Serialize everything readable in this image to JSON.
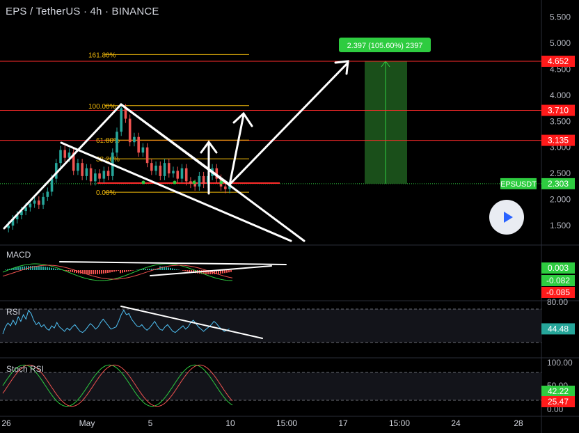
{
  "header": {
    "title": "EPS / TetherUS · 4h · BINANCE"
  },
  "colors": {
    "bg": "#000000",
    "up": "#26a69a",
    "down": "#ef5350",
    "fib": "#f0b90b",
    "resistance": "#ff2b2b",
    "target_box": "#1e5d1e",
    "label_green": "#2ecc40",
    "label_red": "#ff1a1a",
    "drawing": "#ffffff"
  },
  "chart_data": [
    {
      "type": "line",
      "name": "price",
      "x_ticks": [
        "26",
        "May",
        "5",
        "10",
        "15:00",
        "17",
        "15:00",
        "24",
        "28"
      ],
      "y_ticks": [
        "1.500",
        "2.000",
        "2.500",
        "3.000",
        "3.500",
        "4.000",
        "4.500",
        "5.000",
        "5.500"
      ],
      "ylim": [
        1.1,
        5.8
      ],
      "x_index_range": [
        0,
        100
      ],
      "y_values": [
        1.45,
        1.5,
        1.62,
        1.7,
        1.78,
        1.85,
        1.92,
        1.98,
        1.9,
        2.05,
        2.15,
        2.4,
        2.7,
        2.95,
        2.8,
        2.9,
        2.55,
        2.7,
        2.45,
        2.6,
        2.35,
        2.5,
        2.4,
        2.55,
        2.45,
        2.9,
        3.3,
        3.75,
        3.55,
        3.1,
        3.2,
        2.9,
        3.0,
        2.7,
        2.55,
        2.65,
        2.45,
        2.7,
        2.5,
        2.55,
        2.4,
        2.6,
        2.35,
        2.3,
        2.25,
        2.45,
        2.3,
        2.45,
        2.6,
        2.4,
        2.25,
        2.2,
        2.3
      ],
      "fib_levels": [
        {
          "label": "161.80%",
          "value": 4.78
        },
        {
          "label": "100.00%",
          "value": 3.8
        },
        {
          "label": "61.80%",
          "value": 3.14
        },
        {
          "label": "38.20%",
          "value": 2.78
        },
        {
          "label": "0.00%",
          "value": 2.14
        }
      ],
      "resistance_levels": [
        4.652,
        3.71,
        3.135
      ],
      "current_price": 2.303,
      "target_annotation": "2.397 (105.60%) 2397",
      "price_labels": [
        {
          "text": "4.652",
          "value": 4.652,
          "color": "red"
        },
        {
          "text": "3.710",
          "value": 3.71,
          "color": "red"
        },
        {
          "text": "3.135",
          "value": 3.135,
          "color": "red"
        },
        {
          "text": "EPSUSDT",
          "value": 2.303,
          "color": "green",
          "left": true
        },
        {
          "text": "2.303",
          "value": 2.303,
          "color": "green"
        }
      ]
    },
    {
      "type": "bar",
      "name": "MACD",
      "label": "MACD",
      "values": [
        0.003,
        -0.082,
        -0.085
      ],
      "labels": [
        "0.003",
        "-0.082",
        "-0.085"
      ]
    },
    {
      "type": "line",
      "name": "RSI",
      "label": "RSI",
      "y_ticks": [
        "80.00"
      ],
      "value": 44.48,
      "value_label": "44.48",
      "values": [
        35,
        48,
        55,
        50,
        60,
        52,
        66,
        58,
        70,
        62,
        78,
        72,
        60,
        52,
        56,
        48,
        52,
        45,
        42,
        50,
        46,
        56,
        48,
        44,
        40,
        46,
        42,
        48,
        52,
        46,
        40,
        38,
        42,
        48,
        54,
        50,
        44,
        48,
        56,
        62,
        56,
        50,
        44,
        46,
        48,
        58,
        70,
        78,
        70,
        72,
        62,
        56,
        50,
        48,
        52,
        46,
        42,
        46,
        52,
        58,
        50,
        44,
        42,
        48,
        52,
        46,
        40,
        38,
        42,
        46,
        50,
        44,
        48,
        56,
        60,
        54,
        48,
        44,
        40,
        44,
        48,
        52,
        58,
        54,
        48,
        44,
        40,
        42,
        44.48
      ]
    },
    {
      "type": "line",
      "name": "Stoch RSI",
      "label": "Stoch RSI",
      "y_ticks": [
        "100.00",
        "50.00",
        "0.00"
      ],
      "values": [
        42.22,
        25.47
      ],
      "labels": [
        "42.22",
        "25.47"
      ]
    }
  ],
  "time_axis": [
    "26",
    "May",
    "5",
    "10",
    "15:00",
    "17",
    "15:00",
    "24",
    "28"
  ]
}
